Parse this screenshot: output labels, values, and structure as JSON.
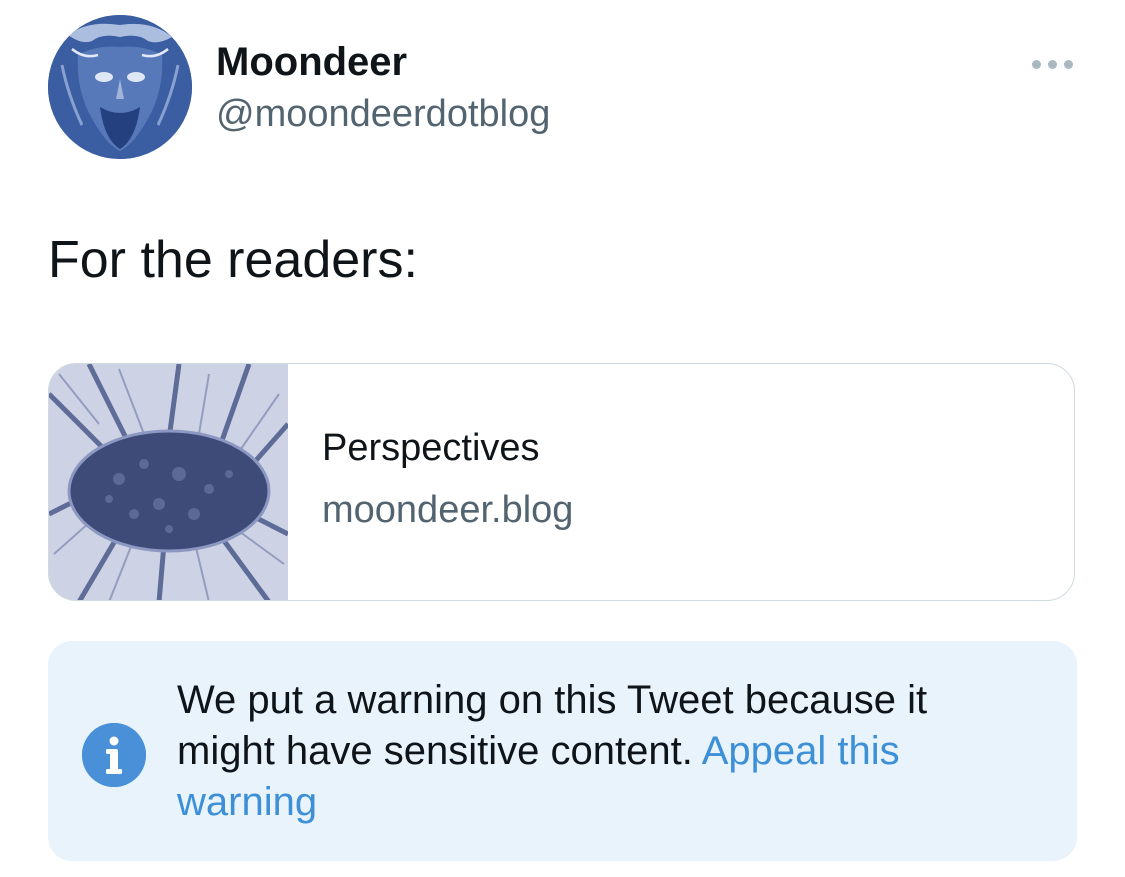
{
  "author": {
    "display_name": "Moondeer",
    "handle": "@moondeerdotblog",
    "avatar_icon": "bearded-face-avatar"
  },
  "more_icon": "ellipsis-icon",
  "tweet": {
    "text": "For the readers:"
  },
  "link_card": {
    "title": "Perspectives",
    "domain": "moondeer.blog",
    "thumbnail": "looking-up-through-trees-thumbnail"
  },
  "warning": {
    "icon": "info-icon",
    "message": "We put a warning on this Tweet because it might have sensitive content.",
    "appeal_link_label": "Appeal this warning"
  },
  "colors": {
    "secondary_text": "#536471",
    "link_blue": "#3d8fd6",
    "notice_background": "#e8f3fc",
    "card_border": "#cfd9de"
  }
}
